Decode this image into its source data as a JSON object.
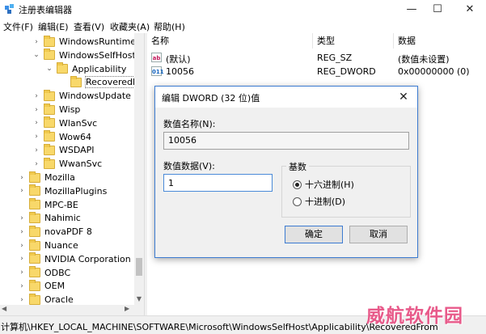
{
  "window": {
    "title": "注册表编辑器",
    "minimize": "—",
    "maximize": "☐",
    "close": "✕"
  },
  "menu": [
    "文件(F)",
    "编辑(E)",
    "查看(V)",
    "收藏夹(A)",
    "帮助(H)"
  ],
  "tree": [
    {
      "label": "WindowsRuntime",
      "expander": "›",
      "level": 2
    },
    {
      "label": "WindowsSelfHost",
      "expander": "⌄",
      "level": 2
    },
    {
      "label": "Applicability",
      "expander": "⌄",
      "level": 3
    },
    {
      "label": "RecoveredFr",
      "expander": "",
      "level": 4,
      "selected": true
    },
    {
      "label": "WindowsUpdate",
      "expander": "›",
      "level": 2
    },
    {
      "label": "Wisp",
      "expander": "›",
      "level": 2
    },
    {
      "label": "WlanSvc",
      "expander": "›",
      "level": 2
    },
    {
      "label": "Wow64",
      "expander": "›",
      "level": 2
    },
    {
      "label": "WSDAPI",
      "expander": "›",
      "level": 2
    },
    {
      "label": "WwanSvc",
      "expander": "›",
      "level": 2
    },
    {
      "label": "Mozilla",
      "expander": "›",
      "level": 1
    },
    {
      "label": "MozillaPlugins",
      "expander": "›",
      "level": 1
    },
    {
      "label": "MPC-BE",
      "expander": "",
      "level": 1
    },
    {
      "label": "Nahimic",
      "expander": "›",
      "level": 1
    },
    {
      "label": "novaPDF 8",
      "expander": "›",
      "level": 1
    },
    {
      "label": "Nuance",
      "expander": "›",
      "level": 1
    },
    {
      "label": "NVIDIA Corporation",
      "expander": "›",
      "level": 1
    },
    {
      "label": "ODBC",
      "expander": "›",
      "level": 1
    },
    {
      "label": "OEM",
      "expander": "›",
      "level": 1
    },
    {
      "label": "Oracle",
      "expander": "›",
      "level": 1
    }
  ],
  "values_list": {
    "columns": [
      "名称",
      "类型",
      "数据"
    ],
    "rows": [
      {
        "icon": "ab",
        "name": "(默认)",
        "type": "REG_SZ",
        "data": "(数值未设置)"
      },
      {
        "icon": "011",
        "name": "10056",
        "type": "REG_DWORD",
        "data": "0x00000000 (0)"
      }
    ]
  },
  "dialog": {
    "title": "编辑 DWORD (32 位)值",
    "close": "✕",
    "name_label": "数值名称(N):",
    "name_value": "10056",
    "data_label": "数值数据(V):",
    "data_value": "1",
    "base_label": "基数",
    "radio_hex": "十六进制(H)",
    "radio_dec": "十进制(D)",
    "selected_base": "hex",
    "ok": "确定",
    "cancel": "取消"
  },
  "status": {
    "path": "计算机\\HKEY_LOCAL_MACHINE\\SOFTWARE\\Microsoft\\WindowsSelfHost\\Applicability\\RecoveredFrom"
  },
  "watermark": "威航软件园",
  "colors": {
    "accent": "#3c7bd1",
    "folder": "#f8d86a",
    "watermark": "#e85a8a"
  }
}
